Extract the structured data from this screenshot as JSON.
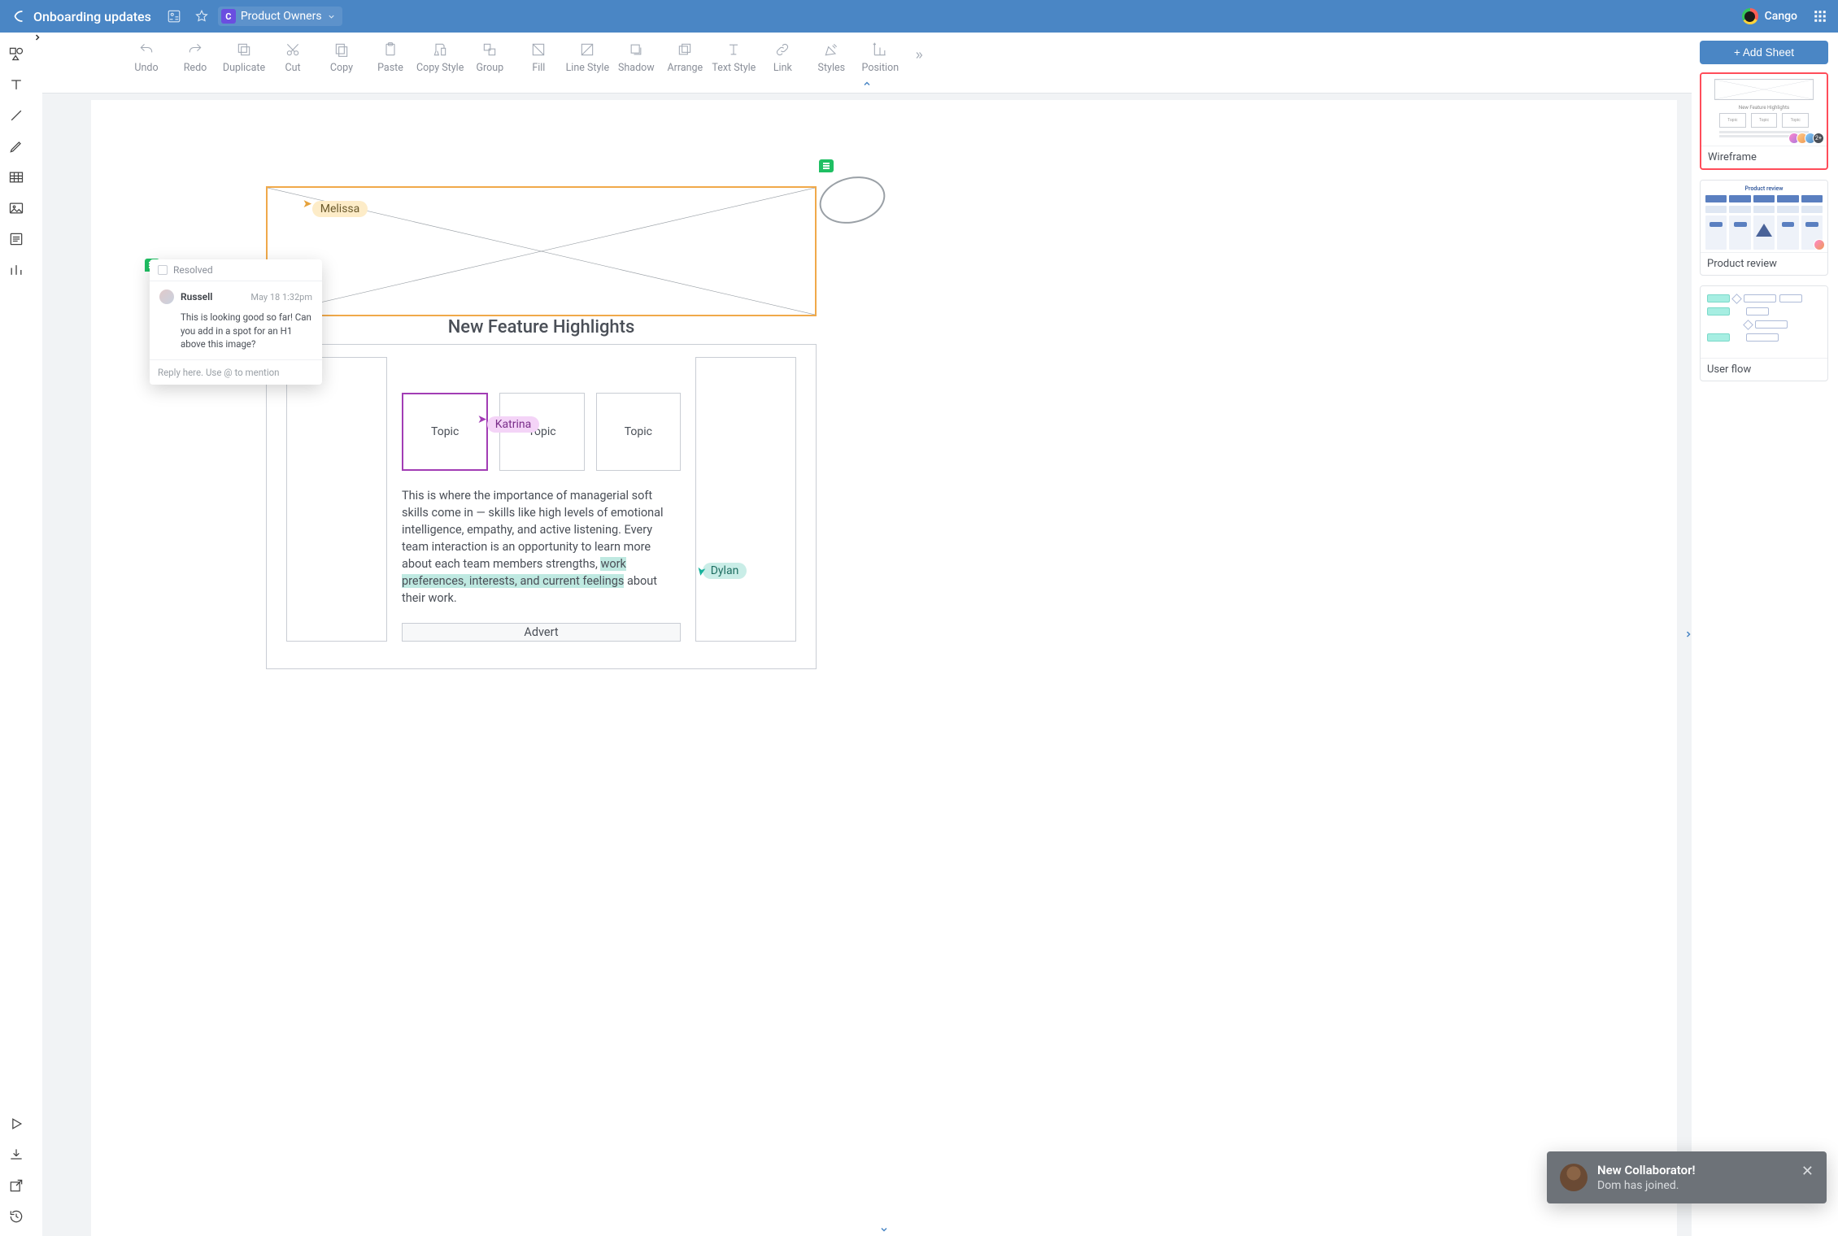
{
  "header": {
    "doc_title": "Onboarding updates",
    "team_label": "Product Owners",
    "brand_name": "Cango"
  },
  "toolbar": {
    "items": [
      {
        "k": "undo",
        "label": "Undo"
      },
      {
        "k": "redo",
        "label": "Redo"
      },
      {
        "k": "duplicate",
        "label": "Duplicate"
      },
      {
        "k": "cut",
        "label": "Cut"
      },
      {
        "k": "copy",
        "label": "Copy"
      },
      {
        "k": "paste",
        "label": "Paste"
      },
      {
        "k": "copystyle",
        "label": "Copy Style"
      },
      {
        "k": "group",
        "label": "Group"
      },
      {
        "k": "fill",
        "label": "Fill"
      },
      {
        "k": "linestyle",
        "label": "Line Style"
      },
      {
        "k": "shadow",
        "label": "Shadow"
      },
      {
        "k": "arrange",
        "label": "Arrange"
      },
      {
        "k": "textstyle",
        "label": "Text Style"
      },
      {
        "k": "link",
        "label": "Link"
      },
      {
        "k": "styles",
        "label": "Styles"
      },
      {
        "k": "position",
        "label": "Position"
      }
    ]
  },
  "cursors": {
    "melissa": "Melissa",
    "katrina": "Katrina",
    "dylan": "Dylan"
  },
  "content": {
    "heading": "New Feature Highlights",
    "topics": [
      "Topic",
      "Topic",
      "Topic"
    ],
    "body_pre": "This is where the importance of managerial soft skills come in — skills like high levels of emotional intelligence, empathy, and active listening. Every team interaction is an opportunity to learn more about each team members strengths, ",
    "body_hl": "work preferences, interests, and current feelings",
    "body_post": " about their work.",
    "advert": "Advert"
  },
  "comment": {
    "resolved_label": "Resolved",
    "user": "Russell",
    "timestamp": "May 18 1:32pm",
    "message": "This is looking good so far! Can you add in a spot for an H1 above this image?",
    "reply_placeholder": "Reply here. Use @ to mention"
  },
  "right": {
    "add_sheet": "+ Add Sheet",
    "sheets": [
      {
        "k": "wireframe",
        "label": "Wireframe",
        "active": true,
        "overflow": "+2+"
      },
      {
        "k": "product_review",
        "label": "Product review",
        "active": false
      },
      {
        "k": "user_flow",
        "label": "User flow",
        "active": false
      }
    ],
    "wire_thumb_title": "New Feature Highlights",
    "wire_thumb_topic": "Topic",
    "prod_thumb_title": "Product review",
    "wire_overflow": "2+"
  },
  "toast": {
    "title": "New Collaborator!",
    "subtitle": "Dom has joined."
  },
  "colors": {
    "header": "#4a86c5",
    "selection_orange": "#f0a94a",
    "selection_purple": "#a23db5",
    "highlight_teal": "#bfe9e1",
    "active_sheet_border": "#ff4d5a"
  }
}
